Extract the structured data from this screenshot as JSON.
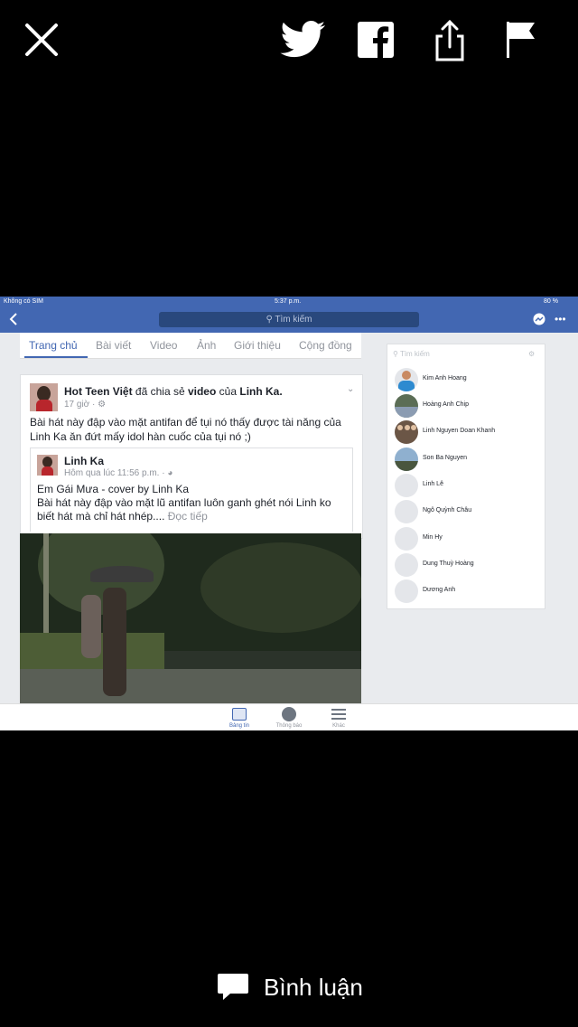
{
  "viewer": {
    "icons": [
      "close-icon",
      "twitter-icon",
      "facebook-icon",
      "share-icon",
      "flag-icon"
    ],
    "comment_label": "Bình luận"
  },
  "status_bar": {
    "carrier": "Không có SIM",
    "time": "5:37 p.m.",
    "battery": "80 %"
  },
  "navbar": {
    "search_placeholder": "Tìm kiếm"
  },
  "tabs": [
    {
      "label": "Trang chủ",
      "active": true
    },
    {
      "label": "Bài viết"
    },
    {
      "label": "Video"
    },
    {
      "label": "Ảnh"
    },
    {
      "label": "Giới thiệu"
    },
    {
      "label": "Cộng đồng"
    }
  ],
  "post": {
    "page_name": "Hot Teen Việt",
    "action_text": "đã chia sẻ",
    "object": "video",
    "of_text": "của",
    "target": "Linh Ka.",
    "time": "17 giờ ·",
    "body": "Bài hát này đập vào mặt antifan để tụi nó thấy được tài năng của Linh Ka ăn đứt mấy idol hàn cuốc của tụi nó ;)",
    "shared": {
      "author": "Linh Ka",
      "time": "Hôm qua lúc 11:56 p.m. ·",
      "title": "Em Gái Mưa - cover by Linh Ka",
      "body": "Bài hát này đập vào mặt lũ antifan luôn ganh ghét nói Linh ko biết hát mà chỉ hát nhép....",
      "more": "Đọc tiếp"
    }
  },
  "friends_panel": {
    "search_placeholder": "Tìm kiếm",
    "friends": [
      "Kim Anh Hoang",
      "Hoàng Anh Chip",
      "Linh Nguyen Doan Khanh",
      "Son Ba Nguyen",
      "Linh Lê",
      "Ngô Quỳnh Châu",
      "Min Hy",
      "Dung Thuỳ Hoàng",
      "Dương Anh"
    ]
  },
  "bottom_tabs": [
    {
      "label": "Bảng tin",
      "active": true
    },
    {
      "label": "Thông báo"
    },
    {
      "label": "Khác"
    }
  ],
  "colors": {
    "facebook_blue": "#4267b2",
    "background": "#000000"
  }
}
